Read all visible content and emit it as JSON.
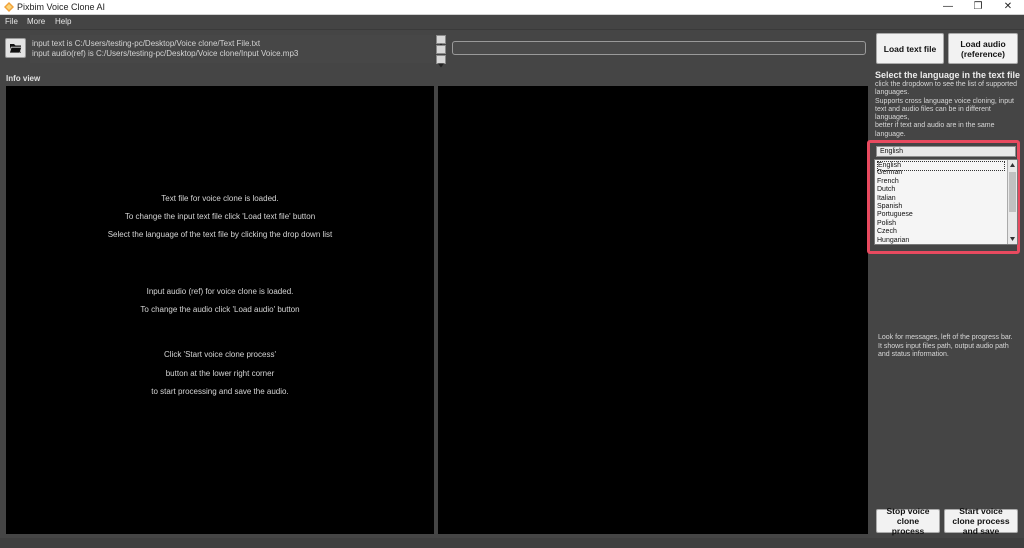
{
  "window": {
    "title": "Pixbim Voice Clone AI",
    "minimize": "—",
    "restore": "❐",
    "close": "✕"
  },
  "menu": [
    "File",
    "More",
    "Help"
  ],
  "paths": {
    "text_line": "input text is C:/Users/testing-pc/Desktop/Voice clone/Text File.txt",
    "audio_line": "input audio(ref) is C:/Users/testing-pc/Desktop/Voice clone/Input Voice.mp3"
  },
  "buttons": {
    "load_text": "Load text file",
    "load_audio": "Load audio (reference)",
    "stop": "Stop voice clone process",
    "start": "Start voice clone process and save"
  },
  "info_view": {
    "label": "Info view",
    "lines": [
      "Text file for voice clone is loaded.",
      "To change the input text file click 'Load text file' button",
      "Select the language of the text file by clicking the drop down list",
      "Input audio (ref) for voice clone is loaded.",
      "To change the audio click 'Load audio' button",
      "Click 'Start voice clone process'",
      "button at the lower right corner",
      "to start processing and save the audio."
    ]
  },
  "language": {
    "heading": "Select the language in the text file",
    "description": "click the dropdown to see the list of supported languages.\nSupports cross language voice cloning, input text and audio files can be in different languages,\nbetter if text and audio are in the same language.",
    "selected": "English",
    "options": [
      "English",
      "German",
      "French",
      "Dutch",
      "Italian",
      "Spanish",
      "Portuguese",
      "Polish",
      "Czech",
      "Hungarian"
    ]
  },
  "help": {
    "text": "Look for messages, left of the progress bar. It shows input files path, output audio path and status information."
  },
  "colors": {
    "background": "#454545",
    "panel": "#000000",
    "highlight": "#e84a5f"
  }
}
